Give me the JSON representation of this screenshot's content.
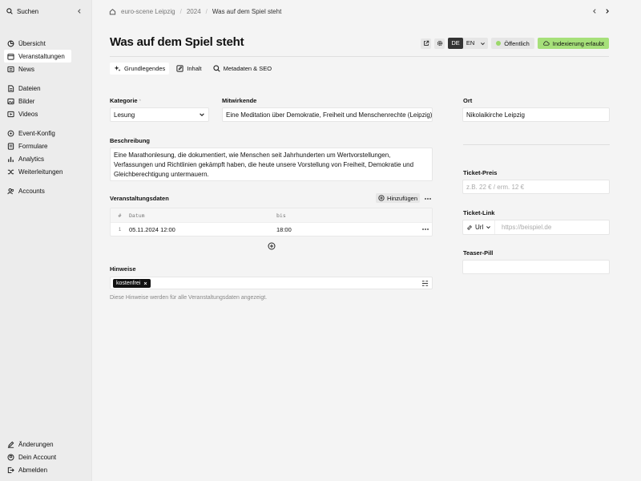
{
  "sidebar": {
    "search_label": "Suchen",
    "items": [
      {
        "label": "Übersicht",
        "icon": "grid-icon"
      },
      {
        "label": "Veranstaltungen",
        "icon": "calendar-icon"
      },
      {
        "label": "News",
        "icon": "news-icon"
      },
      {
        "label": "Dateien",
        "icon": "file-icon"
      },
      {
        "label": "Bilder",
        "icon": "image-icon"
      },
      {
        "label": "Videos",
        "icon": "video-icon"
      },
      {
        "label": "Event-Konfig",
        "icon": "event-config-icon"
      },
      {
        "label": "Formulare",
        "icon": "form-icon"
      },
      {
        "label": "Analytics",
        "icon": "chart-icon"
      },
      {
        "label": "Weiterleitungen",
        "icon": "shuffle-icon"
      },
      {
        "label": "Accounts",
        "icon": "users-icon"
      }
    ],
    "footer": [
      {
        "label": "Änderungen",
        "icon": "edit-icon"
      },
      {
        "label": "Dein Account",
        "icon": "account-icon"
      },
      {
        "label": "Abmelden",
        "icon": "logout-icon"
      }
    ]
  },
  "breadcrumb": {
    "items": [
      "euro-scene Leipzig",
      "2024",
      "Was auf dem Spiel steht"
    ]
  },
  "page": {
    "title": "Was auf dem Spiel steht",
    "lang_de": "DE",
    "lang_en": "EN",
    "status_public": "Öffentlich",
    "indexing": "Indexierung erlaubt"
  },
  "tabs": [
    {
      "label": "Grundlegendes",
      "icon": "sparkle-icon"
    },
    {
      "label": "Inhalt",
      "icon": "edit-doc-icon"
    },
    {
      "label": "Metadaten & SEO",
      "icon": "search-icon"
    }
  ],
  "form": {
    "kategorie_label": "Kategorie",
    "kategorie_req": "*",
    "kategorie_value": "Lesung",
    "mitwirkende_label": "Mitwirkende",
    "mitwirkende_value": "Eine Meditation über Demokratie, Freiheit und Menschenrechte (Leipzig)",
    "beschreibung_label": "Beschreibung",
    "beschreibung_value": "Eine Marathonlesung, die dokumentiert, wie Menschen seit Jahrhunderten um Wertvorstellungen, Verfassungen und Richtlinien gekämpft haben, die heute unsere Vorstellung von Freiheit, Demokratie und Gleichberechtigung untermauern.",
    "veranstaltungsdaten_label": "Veranstaltungsdaten",
    "hinzufuegen": "Hinzufügen",
    "table": {
      "col_num": "#",
      "col_datum": "Datum",
      "col_bis": "bis",
      "rows": [
        {
          "num": "1",
          "datum": "05.11.2024 12:00",
          "bis": "18:00"
        }
      ]
    },
    "hinweise_label": "Hinweise",
    "hinweise_chip": "kostenfrei",
    "hinweise_helper": "Diese Hinweise werden für alle Veranstaltungsdaten angezeigt."
  },
  "right": {
    "ort_label": "Ort",
    "ort_value": "Nikolaikirche Leipzig",
    "preis_label": "Ticket-Preis",
    "preis_placeholder": "z.B. 22 € / erm. 12 €",
    "link_label": "Ticket-Link",
    "link_type": "Url",
    "link_placeholder": "https://beispiel.de",
    "teaser_label": "Teaser-Pill",
    "teaser_value": ""
  }
}
